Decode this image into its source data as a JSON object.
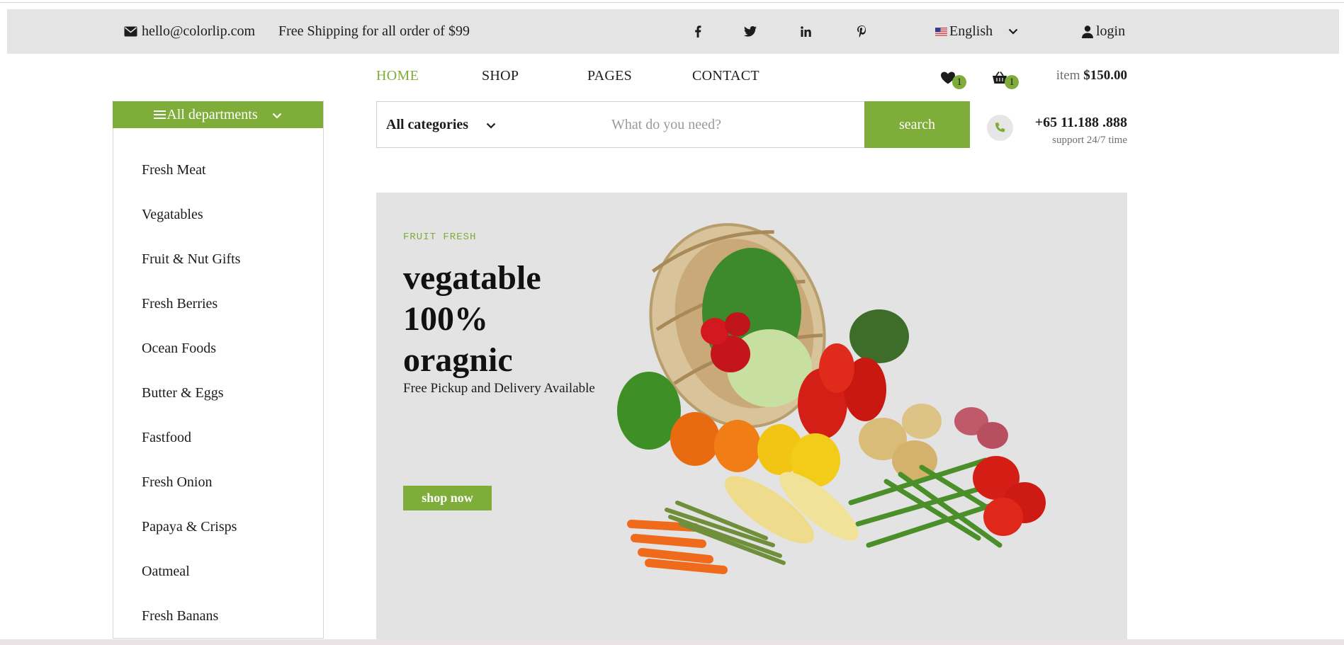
{
  "header_top": {
    "email": "hello@colorlip.com",
    "shipping": "Free Shipping for all order of $99",
    "language": "English",
    "login": "login"
  },
  "nav": {
    "items": [
      {
        "label": "HOME",
        "active": true
      },
      {
        "label": "SHOP",
        "active": false
      },
      {
        "label": "PAGES",
        "active": false
      },
      {
        "label": "CONTACT",
        "active": false
      }
    ]
  },
  "cart": {
    "wishlist_count": "1",
    "cart_count": "1",
    "item_label": "item",
    "total": "$150.00"
  },
  "departments": {
    "title": "All departments",
    "items": [
      "Fresh Meat",
      "Vegatables",
      "Fruit & Nut Gifts",
      "Fresh Berries",
      "Ocean Foods",
      "Butter & Eggs",
      "Fastfood",
      "Fresh Onion",
      "Papaya & Crisps",
      "Oatmeal",
      "Fresh Banans"
    ]
  },
  "search": {
    "category": "All categories",
    "placeholder": "What do you need?",
    "button": "search"
  },
  "support": {
    "phone": "+65 11.188 .888",
    "note": "support 24/7 time"
  },
  "hero": {
    "eyebrow": "FRUIT FRESH",
    "title_line1": "vegatable",
    "title_line2": "100%",
    "title_line3": "oragnic",
    "subtitle": "Free Pickup and Delivery Available",
    "button": "shop now"
  },
  "colors": {
    "accent": "#7fad39",
    "topbar": "#e4e4e4",
    "hero_bg": "#e3e3e3"
  }
}
